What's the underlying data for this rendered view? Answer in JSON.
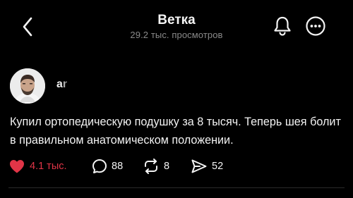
{
  "header": {
    "title": "Ветка",
    "views": "29.2 тыс. просмотров"
  },
  "post": {
    "username": "ar",
    "text": "Купил ортопедическую подушку за 8 тысяч. Теперь шея болит в правильном анатомическом положении.",
    "likes": "4.1 тыс.",
    "comments": "88",
    "reposts": "8",
    "shares": "52"
  },
  "colors": {
    "background": "#000000",
    "like_accent": "#e13547",
    "muted_text": "#8a8a8a"
  },
  "icons": [
    "back-chevron-icon",
    "bell-icon",
    "more-icon",
    "heart-icon",
    "comment-icon",
    "repost-icon",
    "share-icon"
  ]
}
